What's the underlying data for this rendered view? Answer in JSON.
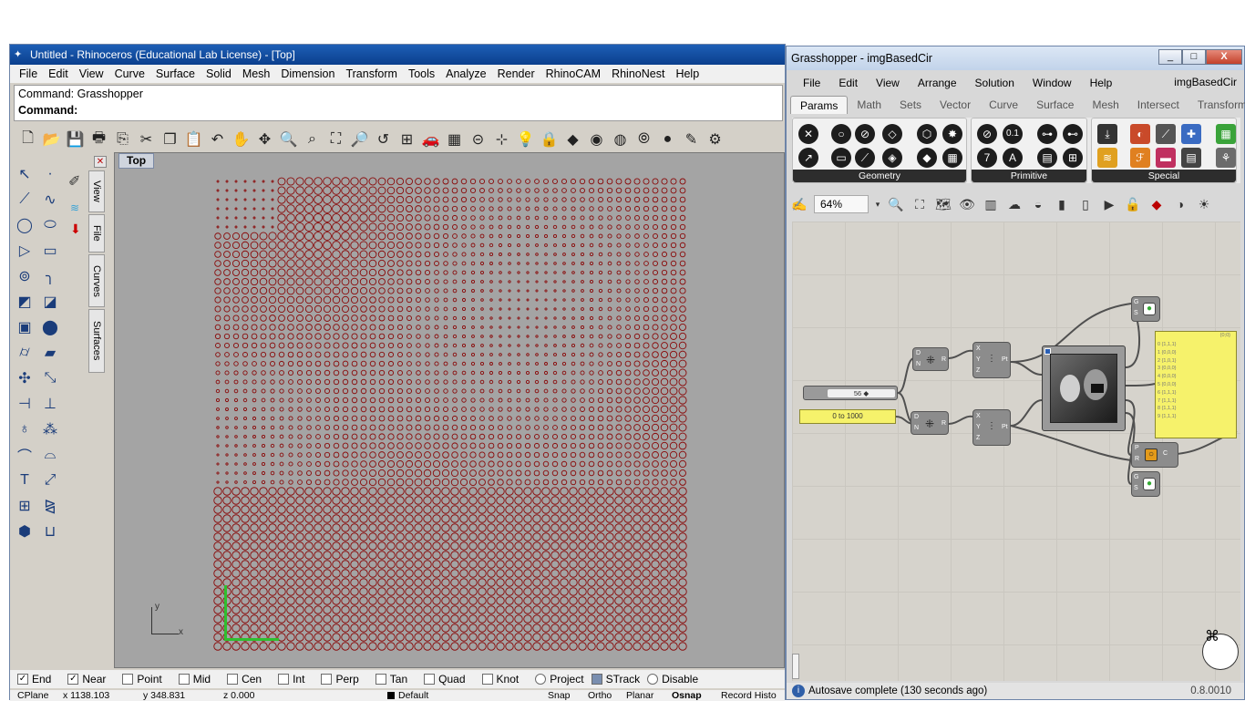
{
  "rhino": {
    "title": "Untitled - Rhinoceros (Educational Lab License) - [Top]",
    "menu": [
      "File",
      "Edit",
      "View",
      "Curve",
      "Surface",
      "Solid",
      "Mesh",
      "Dimension",
      "Transform",
      "Tools",
      "Analyze",
      "Render",
      "RhinoCAM",
      "RhinoNest",
      "Help"
    ],
    "command_history": "Command: Grasshopper",
    "command_prompt": "Command:",
    "side_tabs": [
      "View",
      "File",
      "Curves",
      "Surfaces"
    ],
    "viewport_label": "Top",
    "axis_y": "y",
    "axis_x": "x",
    "osnaps": [
      {
        "label": "End",
        "checked": true
      },
      {
        "label": "Near",
        "checked": true
      },
      {
        "label": "Point",
        "checked": false
      },
      {
        "label": "Mid",
        "checked": false
      },
      {
        "label": "Cen",
        "checked": false
      },
      {
        "label": "Int",
        "checked": false
      },
      {
        "label": "Perp",
        "checked": false
      },
      {
        "label": "Tan",
        "checked": false
      },
      {
        "label": "Quad",
        "checked": false
      },
      {
        "label": "Knot",
        "checked": false
      },
      {
        "label": "Project",
        "checked": false
      },
      {
        "label": "STrack",
        "checked": false
      },
      {
        "label": "Disable",
        "checked": false
      }
    ],
    "status": {
      "cplane": "CPlane",
      "x": "x 1138.103",
      "y": "y 348.831",
      "z": "z 0.000",
      "layer": "Default",
      "snap": "Snap",
      "ortho": "Ortho",
      "planar": "Planar",
      "osnap": "Osnap",
      "record": "Record Histo"
    },
    "colors": {
      "circle": "#8a0a0a",
      "viewport_bg": "#a4a4a4",
      "title_bar": "#0b3f8d"
    }
  },
  "grasshopper": {
    "title": "Grasshopper - imgBasedCir",
    "window_buttons": [
      "_",
      "□",
      "X"
    ],
    "menu": [
      "File",
      "Edit",
      "View",
      "Arrange",
      "Solution",
      "Window",
      "Help"
    ],
    "document_name": "imgBasedCir",
    "tabs": [
      "Params",
      "Math",
      "Sets",
      "Vector",
      "Curve",
      "Surface",
      "Mesh",
      "Intersect",
      "Transform"
    ],
    "active_tab": "Params",
    "ribbon_groups": [
      "Geometry",
      "Primitive",
      "Special"
    ],
    "primitive_labels": [
      "0.1",
      "A"
    ],
    "zoom": "64%",
    "slider_value": "56 ◆",
    "domain_panel": "0 to 1000",
    "component_inputs": {
      "color_node": [
        "G",
        "S"
      ],
      "decompose": [
        "D",
        "N",
        "R"
      ],
      "construct_point": [
        "X",
        "Y",
        "Z",
        "Pt"
      ],
      "circle": [
        "P",
        "R",
        "C"
      ]
    },
    "list_panel_header": "{0;0}",
    "list_panel_rows": [
      "0 {1,1,1}",
      "1 {0,0,0}",
      "2 {1,0,1}",
      "3 {0,0,0}",
      "4 {0,0,0}",
      "5 {0,0,0}",
      "6 {1,1,1}",
      "7 {1,1,1}",
      "8 {1,1,1}",
      "9 {1,1,1}"
    ],
    "status_text": "Autosave complete (130 seconds ago)",
    "version": "0.8.0010"
  }
}
